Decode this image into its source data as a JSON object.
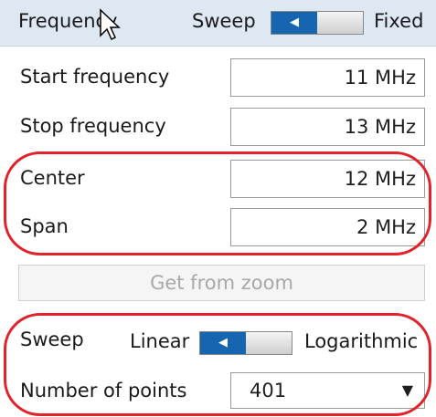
{
  "header": {
    "title": "Frequency",
    "sweep_label": "Sweep",
    "fixed_label": "Fixed"
  },
  "fields": [
    {
      "label": "Start frequency",
      "value": "11 MHz"
    },
    {
      "label": "Stop frequency",
      "value": "13 MHz"
    },
    {
      "label": "Center",
      "value": "12 MHz"
    },
    {
      "label": "Span",
      "value": "2 MHz"
    }
  ],
  "zoom_button": "Get from zoom",
  "sweep": {
    "label": "Sweep",
    "left_option": "Linear",
    "right_option": "Logarithmic"
  },
  "points": {
    "label": "Number of points",
    "value": "401"
  },
  "colors": {
    "accent": "#1565b0",
    "highlight_oval": "#e0232b",
    "header_bg": "#dde8f3"
  },
  "icons": [
    "triangle-left-icon",
    "dropdown-arrow-icon",
    "mouse-cursor-icon"
  ]
}
